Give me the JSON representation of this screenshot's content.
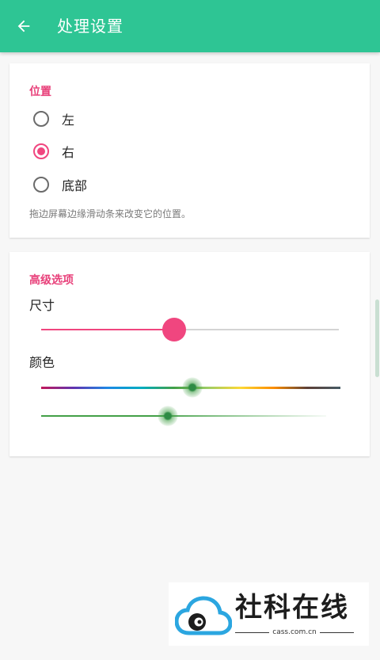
{
  "appbar": {
    "title": "处理设置",
    "back_icon": "arrow-back-icon",
    "color": "#2ec594"
  },
  "position_section": {
    "title": "位置",
    "options": [
      {
        "label": "左",
        "checked": false
      },
      {
        "label": "右",
        "checked": true
      },
      {
        "label": "底部",
        "checked": false
      }
    ],
    "hint": "拖边屏幕边缘滑动条来改变它的位置。"
  },
  "advanced_section": {
    "title": "高级选项",
    "size_label": "尺寸",
    "size_value": 0.45,
    "color_label": "颜色",
    "hue_value": 0.51,
    "shade_value": 0.43
  },
  "colors": {
    "accent": "#f0467f",
    "selected_color": "#43a047"
  },
  "watermark": {
    "text": "社科在线",
    "url": "cass.com.cn"
  }
}
